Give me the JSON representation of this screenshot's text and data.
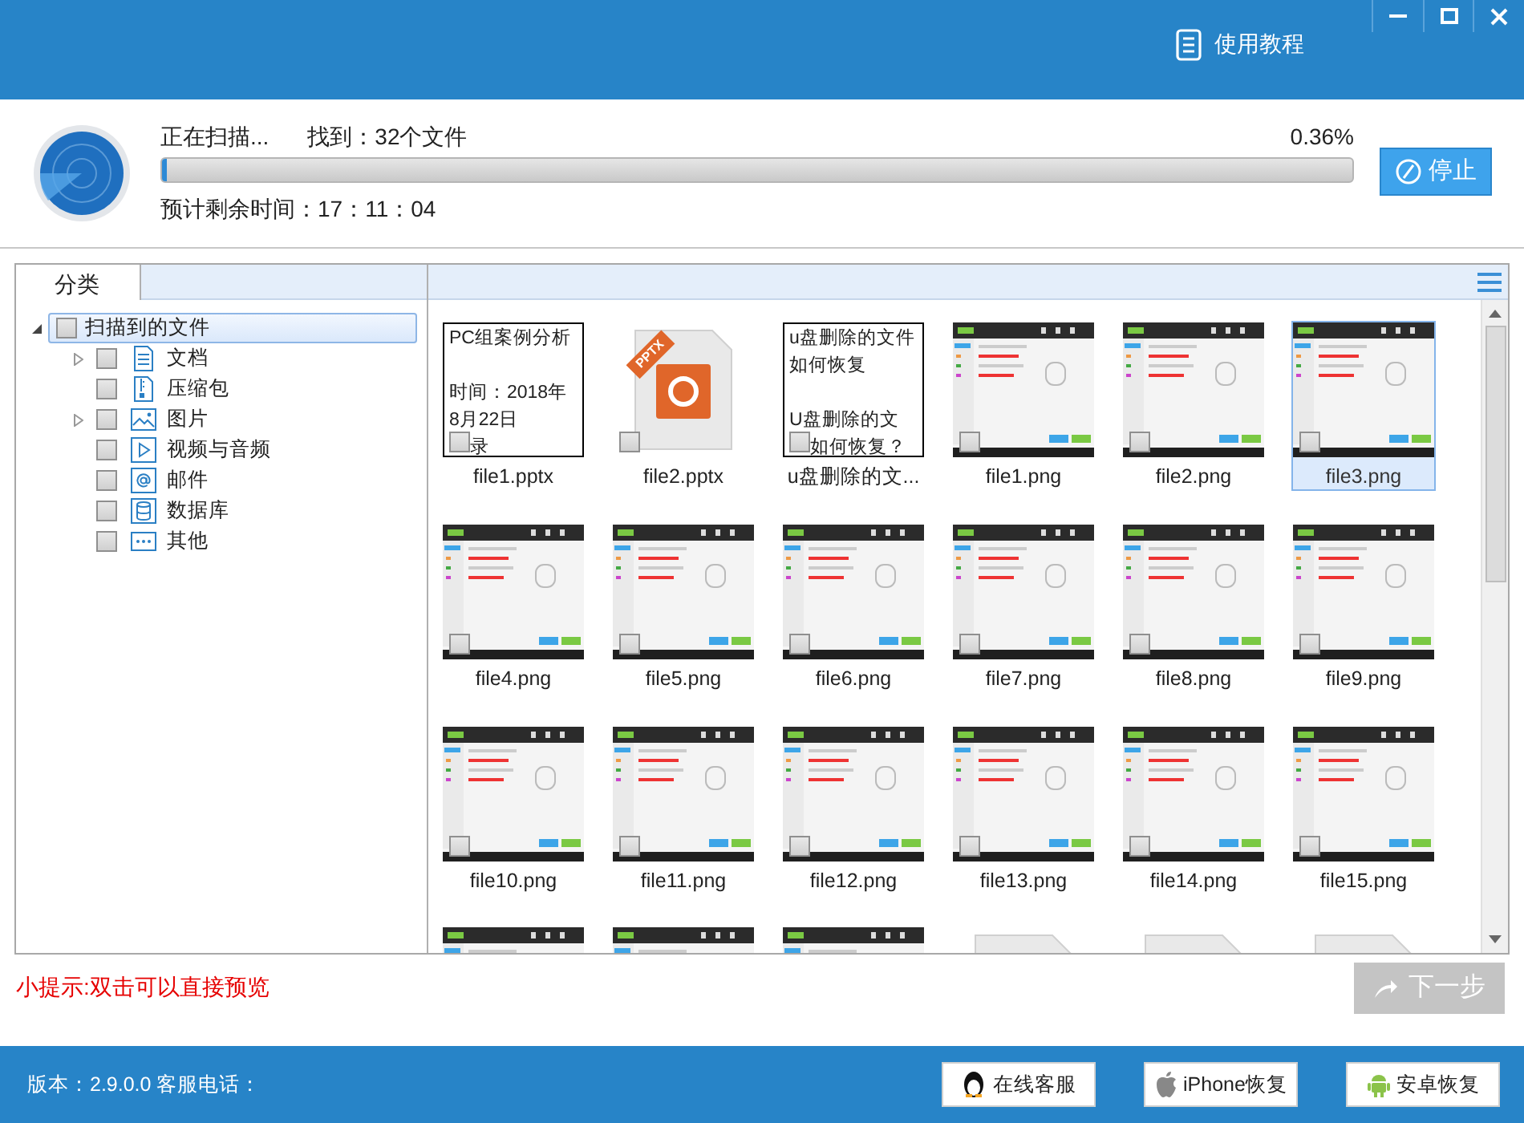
{
  "header": {
    "tutorial_link": "使用教程"
  },
  "scan": {
    "status": "正在扫描...",
    "found": "找到：32个文件",
    "percent": "0.36%",
    "level": 0.0036,
    "remaining": "预计剩余时间：17：11：04",
    "stop_button": "停止"
  },
  "tabs": [
    {
      "label": "分类",
      "selected": true
    }
  ],
  "tree": {
    "label": "扫描到的文件",
    "checked": false,
    "expanded": true,
    "selected": true,
    "children": [
      {
        "label": "文档",
        "kind": "document",
        "checked": false,
        "expandable": true
      },
      {
        "label": "压缩包",
        "kind": "archive",
        "checked": false,
        "expandable": false
      },
      {
        "label": "图片",
        "kind": "image",
        "checked": false,
        "expandable": true
      },
      {
        "label": "视频与音频",
        "kind": "video",
        "checked": false,
        "expandable": false
      },
      {
        "label": "邮件",
        "kind": "mail",
        "checked": false,
        "expandable": false
      },
      {
        "label": "数据库",
        "kind": "database",
        "checked": false,
        "expandable": false
      },
      {
        "label": "其他",
        "kind": "other",
        "checked": false,
        "expandable": false
      }
    ]
  },
  "files": [
    {
      "name": "file1.pptx",
      "kind": "text",
      "paragraphs": [
        [
          "PC组案例分析"
        ],
        [
          "时间：2018年",
          "8月22日",
          "录"
        ]
      ],
      "selected": false,
      "checked": false
    },
    {
      "name": "file2.pptx",
      "kind": "pptx",
      "badge": "PPTX",
      "selected": false,
      "checked": false
    },
    {
      "name": "u盘删除的文...",
      "kind": "text",
      "paragraphs": [
        [
          "u盘删除的文件",
          "如何恢复"
        ],
        [
          "U盘删除的文",
          "如何恢复？"
        ]
      ],
      "selected": false,
      "checked": false
    },
    {
      "name": "file1.png",
      "kind": "screenshot",
      "selected": false,
      "checked": false
    },
    {
      "name": "file2.png",
      "kind": "screenshot",
      "selected": false,
      "checked": false
    },
    {
      "name": "file3.png",
      "kind": "screenshot",
      "selected": true,
      "checked": false
    },
    {
      "name": "file4.png",
      "kind": "screenshot",
      "selected": false,
      "checked": false
    },
    {
      "name": "file5.png",
      "kind": "screenshot",
      "selected": false,
      "checked": false
    },
    {
      "name": "file6.png",
      "kind": "screenshot",
      "selected": false,
      "checked": false
    },
    {
      "name": "file7.png",
      "kind": "screenshot",
      "selected": false,
      "checked": false
    },
    {
      "name": "file8.png",
      "kind": "screenshot",
      "selected": false,
      "checked": false
    },
    {
      "name": "file9.png",
      "kind": "screenshot",
      "selected": false,
      "checked": false
    },
    {
      "name": "file10.png",
      "kind": "screenshot",
      "selected": false,
      "checked": false
    },
    {
      "name": "file11.png",
      "kind": "screenshot",
      "selected": false,
      "checked": false
    },
    {
      "name": "file12.png",
      "kind": "screenshot",
      "selected": false,
      "checked": false
    },
    {
      "name": "file13.png",
      "kind": "screenshot",
      "selected": false,
      "checked": false
    },
    {
      "name": "file14.png",
      "kind": "screenshot",
      "selected": false,
      "checked": false
    },
    {
      "name": "file15.png",
      "kind": "screenshot",
      "selected": false,
      "checked": false
    }
  ],
  "partial_row": [
    {
      "kind": "screenshot"
    },
    {
      "kind": "screenshot"
    },
    {
      "kind": "screenshot"
    },
    {
      "kind": "pptx"
    },
    {
      "kind": "pptx"
    },
    {
      "kind": "pptx"
    }
  ],
  "hint": "小提示:双击可以直接预览",
  "next_button": {
    "label": "下一步",
    "disabled": true
  },
  "footer": {
    "version": "版本：2.9.0.0 客服电话：",
    "buttons": [
      {
        "label": "在线客服",
        "kind": "qq"
      },
      {
        "label": "iPhone恢复",
        "kind": "apple"
      },
      {
        "label": "安卓恢复",
        "kind": "android"
      }
    ]
  }
}
